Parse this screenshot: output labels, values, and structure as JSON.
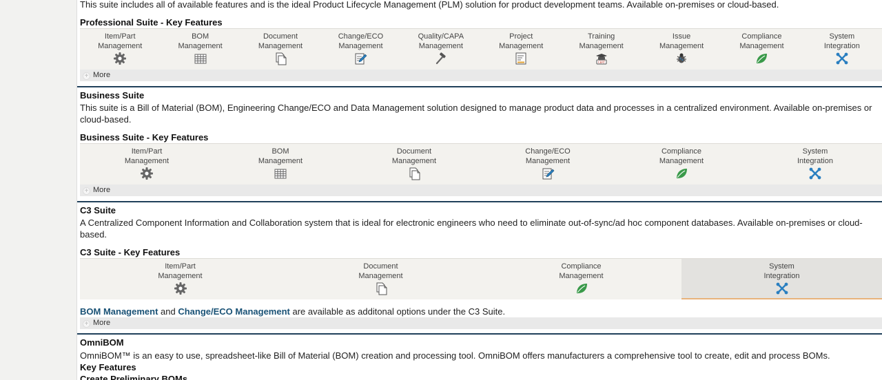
{
  "professional": {
    "desc_line": "This suite includes all of available features and is the ideal Product Lifecycle Management (PLM) solution for product development teams. Available on-premises or cloud-based.",
    "features_title": "Professional Suite - Key Features",
    "features": [
      {
        "line1": "Item/Part",
        "line2": "Management",
        "icon": "gear-icon"
      },
      {
        "line1": "BOM",
        "line2": "Management",
        "icon": "table-grid-icon"
      },
      {
        "line1": "Document",
        "line2": "Management",
        "icon": "documents-icon"
      },
      {
        "line1": "Change/ECO",
        "line2": "Management",
        "icon": "edit-document-icon"
      },
      {
        "line1": "Quality/CAPA",
        "line2": "Management",
        "icon": "hammer-icon"
      },
      {
        "line1": "Project",
        "line2": "Management",
        "icon": "project-icon"
      },
      {
        "line1": "Training",
        "line2": "Management",
        "icon": "training-icon"
      },
      {
        "line1": "Issue",
        "line2": "Management",
        "icon": "bug-icon"
      },
      {
        "line1": "Compliance",
        "line2": "Management",
        "icon": "leaf-icon"
      },
      {
        "line1": "System",
        "line2": "Integration",
        "icon": "integration-icon"
      }
    ],
    "more": "More"
  },
  "business": {
    "title": "Business Suite",
    "desc_line1": "This suite is a Bill of Material (BOM), Engineering Change/ECO and Data Management solution designed to manage product data and processes in a centralized environment. Available on-premises or",
    "desc_line2": "cloud-based.",
    "features_title": "Business Suite - Key Features",
    "features": [
      {
        "line1": "Item/Part",
        "line2": "Management",
        "icon": "gear-icon"
      },
      {
        "line1": "BOM",
        "line2": "Management",
        "icon": "table-grid-icon"
      },
      {
        "line1": "Document",
        "line2": "Management",
        "icon": "documents-icon"
      },
      {
        "line1": "Change/ECO",
        "line2": "Management",
        "icon": "edit-document-icon"
      },
      {
        "line1": "Compliance",
        "line2": "Management",
        "icon": "leaf-icon"
      },
      {
        "line1": "System",
        "line2": "Integration",
        "icon": "integration-icon"
      }
    ],
    "more": "More"
  },
  "c3": {
    "title": "C3 Suite",
    "desc_line1": "A Centralized Component Information and Collaboration system that is ideal for electronic engineers who need to eliminate out-of-sync/ad hoc component databases. Available on-premises or cloud-",
    "desc_line2": "based.",
    "features_title": "C3 Suite - Key Features",
    "features": [
      {
        "line1": "Item/Part",
        "line2": "Management",
        "icon": "gear-icon"
      },
      {
        "line1": "Document",
        "line2": "Management",
        "icon": "documents-icon"
      },
      {
        "line1": "Compliance",
        "line2": "Management",
        "icon": "leaf-icon"
      },
      {
        "line1": "System",
        "line2": "Integration",
        "icon": "integration-icon"
      }
    ],
    "note_link1": "BOM Management",
    "note_and": " and ",
    "note_link2": "Change/ECO Management",
    "note_rest": " are available as additonal options under the C3 Suite.",
    "more": "More"
  },
  "omnibom": {
    "title": "OmniBOM",
    "desc": "OmniBOM™ is an easy to use, spreadsheet-like Bill of Material (BOM) creation and processing tool. OmniBOM offers manufacturers a comprehensive tool to create, edit and process BOMs.",
    "key_features": "Key Features",
    "sub_heading": "Create Preliminary BOMs"
  },
  "colors": {
    "link": "#1a5276",
    "separator": "#1f3f5a",
    "active_tab_border": "#e8b27a",
    "leaf": "#3a9a4a",
    "integration": "#2a7fc0"
  }
}
